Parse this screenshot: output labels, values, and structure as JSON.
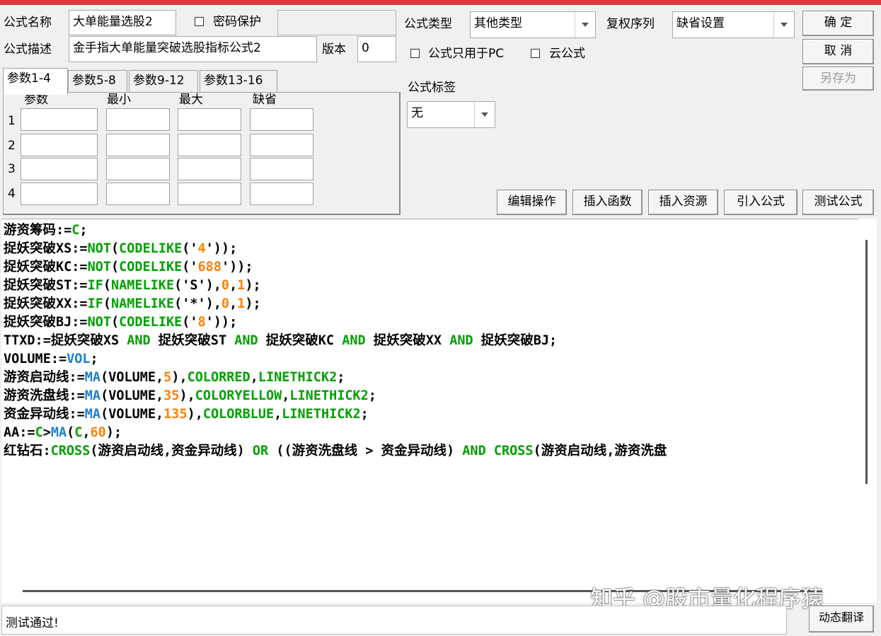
{
  "header": {
    "name_label": "公式名称",
    "name_value": "大单能量选股2",
    "password_label": "密码保护",
    "desc_label": "公式描述",
    "desc_value": "金手指大单能量突破选股指标公式2",
    "version_label": "版本",
    "version_value": "0",
    "type_label": "公式类型",
    "type_value": "其他类型",
    "restore_label": "复权序列",
    "restore_value": "缺省设置",
    "pc_only_label": "公式只用于PC",
    "cloud_label": "云公式",
    "tag_label": "公式标签",
    "tag_value": "无"
  },
  "buttons": {
    "ok": "确  定",
    "cancel": "取  消",
    "save_as": "另存为",
    "edit_ops": "编辑操作",
    "insert_func": "插入函数",
    "insert_res": "插入资源",
    "import_formula": "引入公式",
    "test_formula": "测试公式",
    "dyn_translate": "动态翻译"
  },
  "tabs": [
    "参数1-4",
    "参数5-8",
    "参数9-12",
    "参数13-16"
  ],
  "params": {
    "col_headers": [
      "参数",
      "最小",
      "最大",
      "缺省"
    ],
    "rows": [
      "1",
      "2",
      "3",
      "4"
    ]
  },
  "code_lines": [
    [
      [
        "游资筹码:=",
        "#000000"
      ],
      [
        "C",
        "#00a000"
      ],
      [
        ";",
        "#000000"
      ]
    ],
    [
      [
        "捉妖突破XS:=",
        "#000000"
      ],
      [
        "NOT",
        "#00a000"
      ],
      [
        "(",
        "#000000"
      ],
      [
        "CODELIKE",
        "#00a000"
      ],
      [
        "('",
        "#000000"
      ],
      [
        "4",
        "#ff8000"
      ],
      [
        "'));",
        "#000000"
      ]
    ],
    [
      [
        "捉妖突破KC:=",
        "#000000"
      ],
      [
        "NOT",
        "#00a000"
      ],
      [
        "(",
        "#000000"
      ],
      [
        "CODELIKE",
        "#00a000"
      ],
      [
        "('",
        "#000000"
      ],
      [
        "688",
        "#ff8000"
      ],
      [
        "'));",
        "#000000"
      ]
    ],
    [
      [
        "捉妖突破ST:=",
        "#000000"
      ],
      [
        "IF",
        "#00a000"
      ],
      [
        "(",
        "#000000"
      ],
      [
        "NAMELIKE",
        "#00a000"
      ],
      [
        "('S'),",
        "#000000"
      ],
      [
        "0",
        "#ff8000"
      ],
      [
        ",",
        "#000000"
      ],
      [
        "1",
        "#ff8000"
      ],
      [
        ");",
        "#000000"
      ]
    ],
    [
      [
        "捉妖突破XX:=",
        "#000000"
      ],
      [
        "IF",
        "#00a000"
      ],
      [
        "(",
        "#000000"
      ],
      [
        "NAMELIKE",
        "#00a000"
      ],
      [
        "('*'),",
        "#000000"
      ],
      [
        "0",
        "#ff8000"
      ],
      [
        ",",
        "#000000"
      ],
      [
        "1",
        "#ff8000"
      ],
      [
        ");",
        "#000000"
      ]
    ],
    [
      [
        "捉妖突破BJ:=",
        "#000000"
      ],
      [
        "NOT",
        "#00a000"
      ],
      [
        "(",
        "#000000"
      ],
      [
        "CODELIKE",
        "#00a000"
      ],
      [
        "('",
        "#000000"
      ],
      [
        "8",
        "#ff8000"
      ],
      [
        "'));",
        "#000000"
      ]
    ],
    [
      [
        "TTXD:=捉妖突破XS ",
        "#000000"
      ],
      [
        "AND",
        "#00a000"
      ],
      [
        " 捉妖突破ST ",
        "#000000"
      ],
      [
        "AND",
        "#00a000"
      ],
      [
        " 捉妖突破KC ",
        "#000000"
      ],
      [
        "AND",
        "#00a000"
      ],
      [
        " 捉妖突破XX ",
        "#000000"
      ],
      [
        "AND",
        "#00a000"
      ],
      [
        " 捉妖突破BJ;",
        "#000000"
      ]
    ],
    [
      [
        "VOLUME:=",
        "#000000"
      ],
      [
        "VOL",
        "#1e7fd0"
      ],
      [
        ";",
        "#000000"
      ]
    ],
    [
      [
        "游资启动线:=",
        "#000000"
      ],
      [
        "MA",
        "#1e7fd0"
      ],
      [
        "(VOLUME,",
        "#000000"
      ],
      [
        "5",
        "#ff8000"
      ],
      [
        "),",
        "#000000"
      ],
      [
        "COLORRED",
        "#00a000"
      ],
      [
        ",",
        "#000000"
      ],
      [
        "LINETHICK2",
        "#00a000"
      ],
      [
        ";",
        "#000000"
      ]
    ],
    [
      [
        "游资洗盘线:=",
        "#000000"
      ],
      [
        "MA",
        "#1e7fd0"
      ],
      [
        "(VOLUME,",
        "#000000"
      ],
      [
        "35",
        "#ff8000"
      ],
      [
        "),",
        "#000000"
      ],
      [
        "COLORYELLOW",
        "#00a000"
      ],
      [
        ",",
        "#000000"
      ],
      [
        "LINETHICK2",
        "#00a000"
      ],
      [
        ";",
        "#000000"
      ]
    ],
    [
      [
        "资金异动线:=",
        "#000000"
      ],
      [
        "MA",
        "#1e7fd0"
      ],
      [
        "(VOLUME,",
        "#000000"
      ],
      [
        "135",
        "#ff8000"
      ],
      [
        "),",
        "#000000"
      ],
      [
        "COLORBLUE",
        "#00a000"
      ],
      [
        ",",
        "#000000"
      ],
      [
        "LINETHICK2",
        "#00a000"
      ],
      [
        ";",
        "#000000"
      ]
    ],
    [
      [
        "AA:=",
        "#000000"
      ],
      [
        "C",
        "#00a000"
      ],
      [
        ">",
        "#000000"
      ],
      [
        "MA",
        "#1e7fd0"
      ],
      [
        "(",
        "#000000"
      ],
      [
        "C",
        "#00a000"
      ],
      [
        ",",
        "#000000"
      ],
      [
        "60",
        "#ff8000"
      ],
      [
        ");",
        "#000000"
      ]
    ],
    [
      [
        "红钻石:",
        "#000000"
      ],
      [
        "CROSS",
        "#00a000"
      ],
      [
        "(游资启动线,资金异动线) ",
        "#000000"
      ],
      [
        "OR",
        "#00a000"
      ],
      [
        " ((游资洗盘线 > 资金异动线) ",
        "#000000"
      ],
      [
        "AND",
        "#00a000"
      ],
      [
        " ",
        "#000000"
      ],
      [
        "CROSS",
        "#00a000"
      ],
      [
        "(游资启动线,游资洗盘",
        "#000000"
      ]
    ]
  ],
  "status_text": "测试通过!",
  "watermark": "知乎 @股市量化程序猿"
}
